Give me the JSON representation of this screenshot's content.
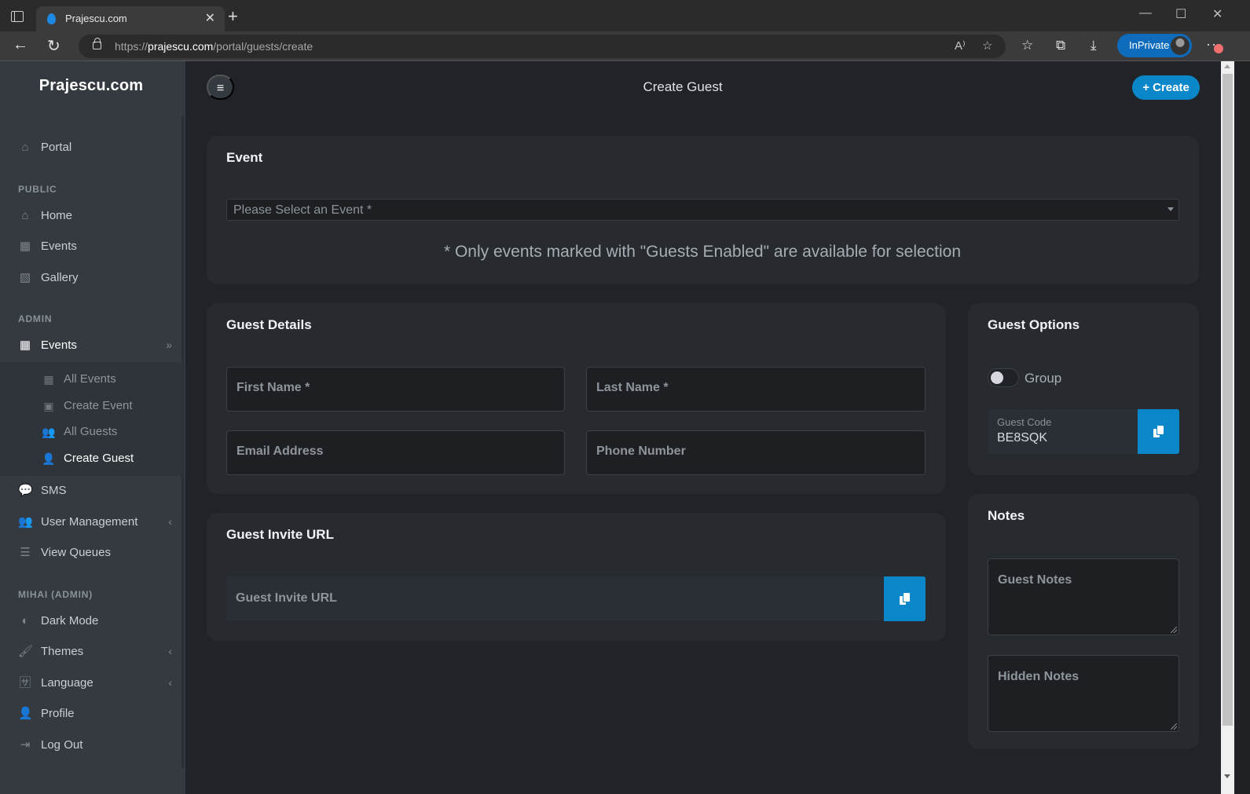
{
  "browser": {
    "tab_title": "Prajescu.com",
    "url_scheme": "https://",
    "url_host": "prajescu.com",
    "url_path": "/portal/guests/create",
    "inprivate_label": "InPrivate"
  },
  "sidebar": {
    "brand": "Prajescu.com",
    "portal": {
      "label": "Portal",
      "icon": "house-user-icon"
    },
    "sections": {
      "public": "PUBLIC",
      "admin": "ADMIN",
      "user": "MIHAI (ADMIN)"
    },
    "public_items": [
      {
        "label": "Home",
        "icon": "home-icon"
      },
      {
        "label": "Events",
        "icon": "calendar-icon"
      },
      {
        "label": "Gallery",
        "icon": "images-icon"
      }
    ],
    "admin_items": {
      "events": {
        "label": "Events",
        "icon": "calendar-icon",
        "expanded": true,
        "children": [
          {
            "label": "All Events",
            "icon": "calendar-icon",
            "active": false
          },
          {
            "label": "Create Event",
            "icon": "calendar-plus-icon",
            "active": false
          },
          {
            "label": "All Guests",
            "icon": "users-icon",
            "active": false
          },
          {
            "label": "Create Guest",
            "icon": "user-tie-icon",
            "active": true
          }
        ]
      },
      "sms": {
        "label": "SMS",
        "icon": "sms-icon"
      },
      "user_management": {
        "label": "User Management",
        "icon": "user-group-icon"
      },
      "view_queues": {
        "label": "View Queues",
        "icon": "list-icon"
      }
    },
    "user_items": [
      {
        "label": "Dark Mode",
        "icon": "circle-half-icon"
      },
      {
        "label": "Themes",
        "icon": "paint-brush-icon"
      },
      {
        "label": "Language",
        "icon": "language-icon"
      },
      {
        "label": "Profile",
        "icon": "user-gear-icon"
      },
      {
        "label": "Log Out",
        "icon": "sign-out-icon"
      }
    ]
  },
  "header": {
    "title": "Create Guest",
    "create_label": "+ Create"
  },
  "event_card": {
    "title": "Event",
    "select_placeholder": "Please Select an Event *",
    "note": "* Only events marked with \"Guests Enabled\" are available for selection"
  },
  "guest_details": {
    "title": "Guest Details",
    "first_name": "First Name *",
    "last_name": "Last Name *",
    "email": "Email Address",
    "phone": "Phone Number"
  },
  "guest_invite": {
    "title": "Guest Invite URL",
    "placeholder": "Guest Invite URL"
  },
  "guest_options": {
    "title": "Guest Options",
    "group_label": "Group",
    "group_enabled": false,
    "code_label": "Guest Code",
    "code_value": "BE8SQK"
  },
  "notes": {
    "title": "Notes",
    "guest_notes": "Guest Notes",
    "hidden_notes": "Hidden Notes"
  }
}
